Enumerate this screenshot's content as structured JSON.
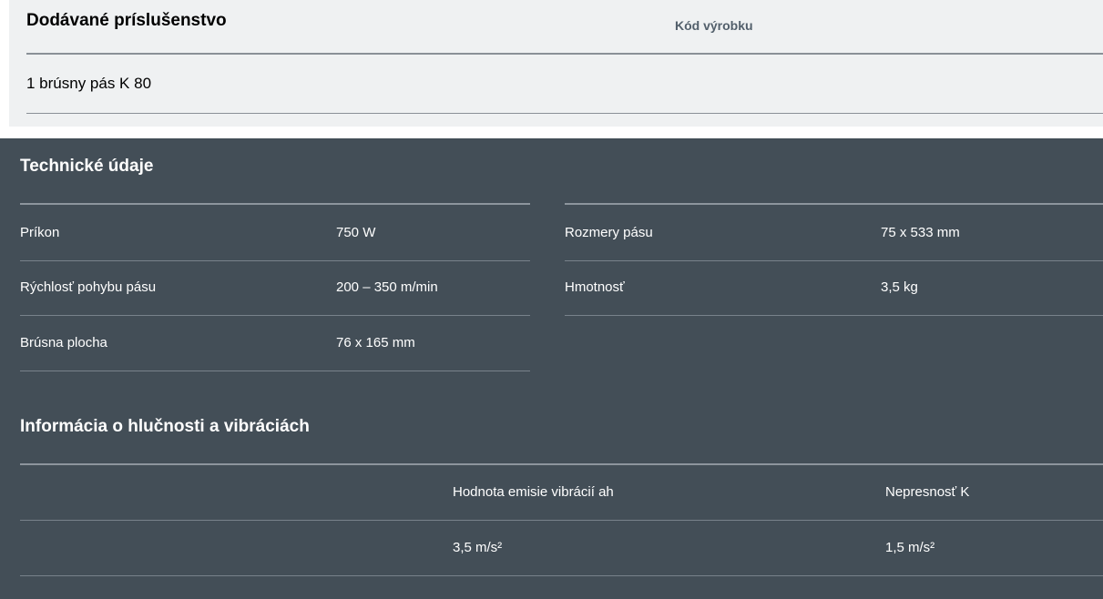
{
  "accessories": {
    "title": "Dodávané príslušenstvo",
    "code_header": "Kód výrobku",
    "items": [
      "1 brúsny pás K 80"
    ]
  },
  "technical": {
    "title": "Technické údaje",
    "left_rows": [
      {
        "label": "Príkon",
        "value": "750 W"
      },
      {
        "label": "Rýchlosť pohybu pásu",
        "value": "200 – 350 m/min"
      },
      {
        "label": "Brúsna plocha",
        "value": "76 x 165 mm"
      }
    ],
    "right_rows": [
      {
        "label": "Rozmery pásu",
        "value": "75 x 533 mm"
      },
      {
        "label": "Hmotnosť",
        "value": "3,5 kg"
      }
    ]
  },
  "noise": {
    "title": "Informácia o hlučnosti a vibráciách",
    "headers": [
      "",
      "Hodnota emisie vibrácií ah",
      "Nepresnosť K"
    ],
    "rows": [
      [
        "",
        "3,5 m/s²",
        "1,5 m/s²"
      ]
    ]
  }
}
